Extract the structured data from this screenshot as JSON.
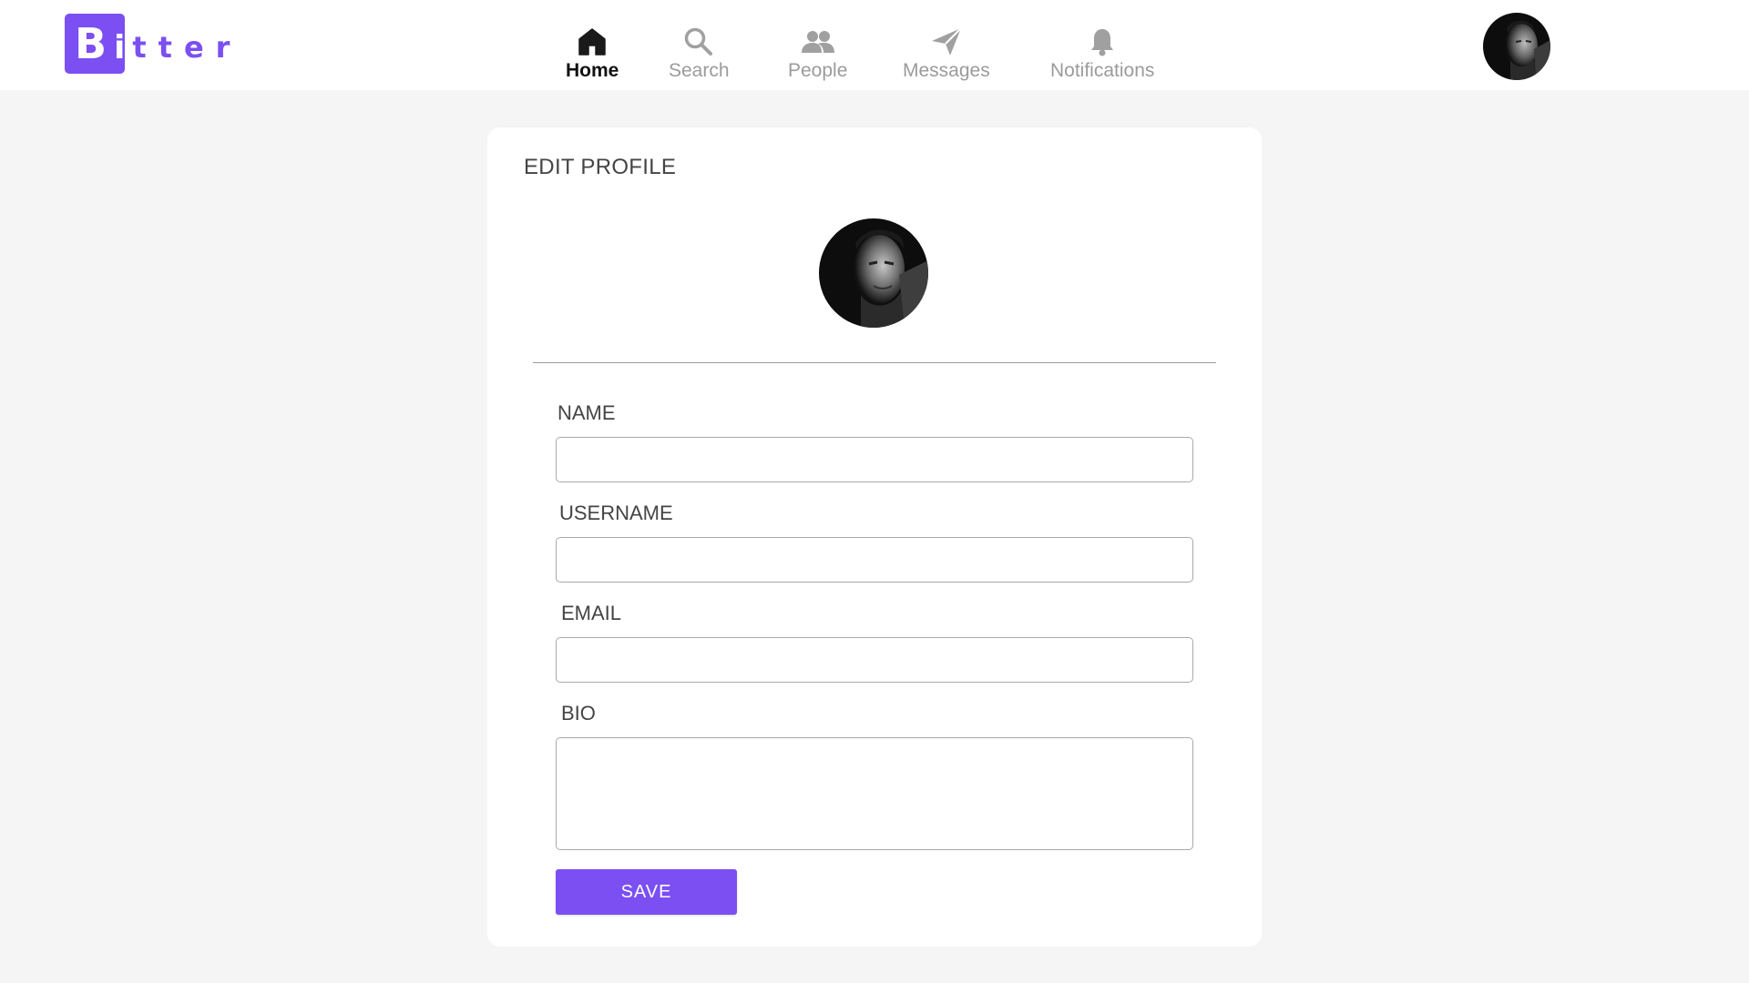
{
  "app": {
    "logo_first": "B",
    "logo_i": "i",
    "logo_rest": "tter"
  },
  "nav": {
    "items": [
      {
        "label": "Home",
        "icon": "home-icon",
        "active": true
      },
      {
        "label": "Search",
        "icon": "search-icon",
        "active": false
      },
      {
        "label": "People",
        "icon": "people-icon",
        "active": false
      },
      {
        "label": "Messages",
        "icon": "send-icon",
        "active": false
      },
      {
        "label": "Notifications",
        "icon": "bell-icon",
        "active": false
      }
    ]
  },
  "edit_profile": {
    "title": "EDIT PROFILE",
    "fields": {
      "name_label": "NAME",
      "name_value": "",
      "username_label": "USERNAME",
      "username_value": "",
      "email_label": "EMAIL",
      "email_value": "",
      "bio_label": "BIO",
      "bio_value": ""
    },
    "save_label": "SAVE"
  },
  "colors": {
    "accent": "#7b4ff2",
    "page_bg": "#f5f5f5",
    "card_bg": "#ffffff",
    "nav_inactive": "#9b9b9b",
    "nav_active": "#111111"
  }
}
